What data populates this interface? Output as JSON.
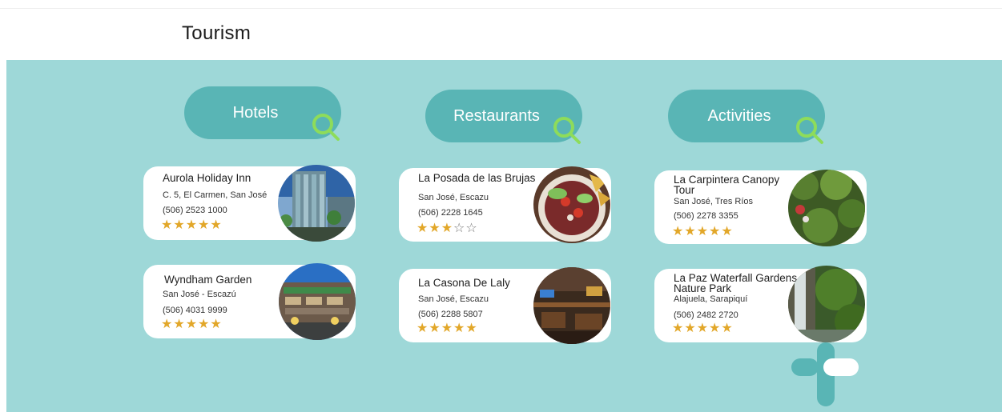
{
  "header": {
    "title": "Tourism"
  },
  "categories": [
    {
      "label": "Hotels"
    },
    {
      "label": "Restaurants"
    },
    {
      "label": "Activities"
    }
  ],
  "hotels": [
    {
      "name": "Aurola Holiday Inn",
      "address": "C. 5, El Carmen, San José",
      "phone": "(506) 2523 1000",
      "stars": "★★★★★",
      "empty": ""
    },
    {
      "name": "Wyndham Garden",
      "address": "San José - Escazú",
      "phone": "(506) 4031 9999",
      "stars": "★★★★★",
      "empty": ""
    }
  ],
  "restaurants": [
    {
      "name": "La Posada de las Brujas",
      "address": "San José, Escazu",
      "phone": "(506) 2228 1645",
      "stars": "★★★",
      "empty": "☆☆"
    },
    {
      "name": "La Casona De Laly",
      "address": "San José, Escazu",
      "phone": "(506) 2288 5807",
      "stars": "★★★★★",
      "empty": ""
    }
  ],
  "activities": [
    {
      "name": "La Carpintera Canopy Tour",
      "address": "San José, Tres Ríos",
      "phone": "(506) 2278 3355",
      "stars": "★★★★★",
      "empty": ""
    },
    {
      "name": "La Paz Waterfall Gardens Nature Park",
      "address": "Alajuela, Sarapiquí",
      "phone": "(506) 2482 2720",
      "stars": "★★★★★",
      "empty": ""
    }
  ],
  "colors": {
    "background": "#9ed8d8",
    "pill": "#59b5b5",
    "magnifier": "#8edc5a",
    "star": "#e2a729",
    "logo": "#59b5b5"
  },
  "icons": [
    "search-icon",
    "star-icon",
    "plus-logo"
  ]
}
